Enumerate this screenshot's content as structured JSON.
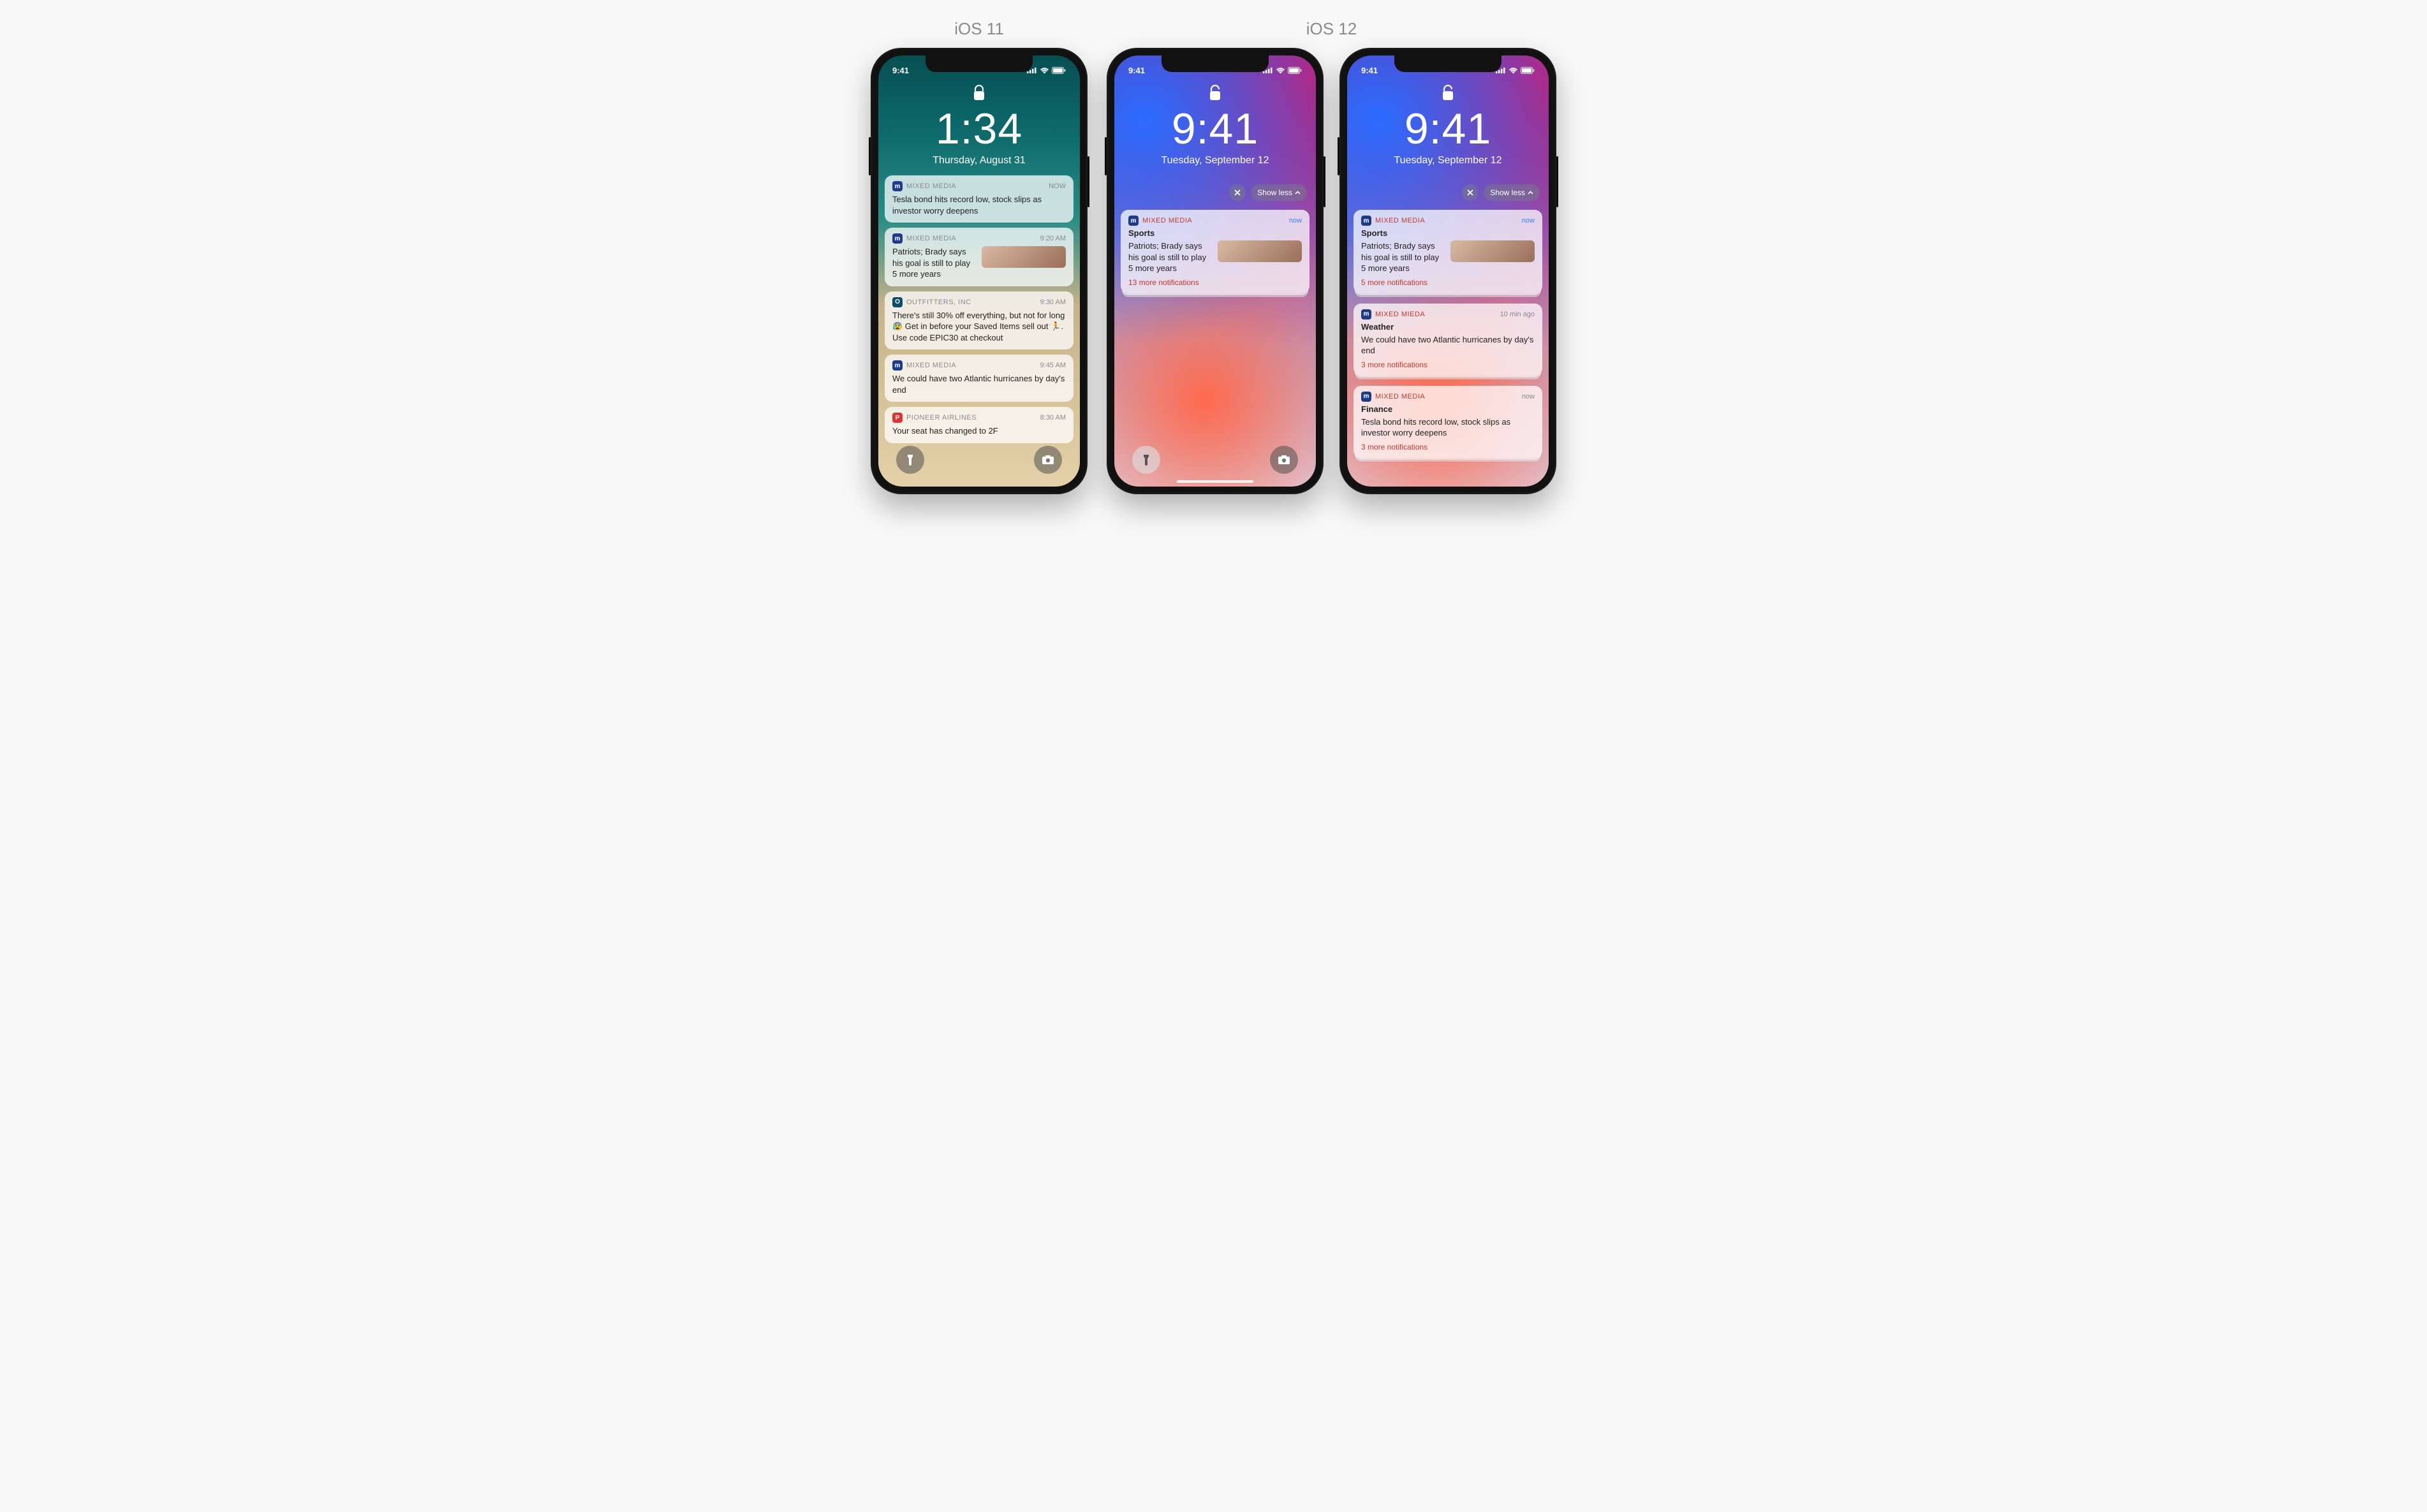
{
  "labels": {
    "ios11": "iOS 11",
    "ios12": "iOS 12"
  },
  "status": {
    "time": "9:41"
  },
  "controls": {
    "showless": "Show less"
  },
  "p1": {
    "time": "1:34",
    "date": "Thursday, August 31",
    "n": [
      {
        "app": "MIXED MEDIA",
        "when": "NOW",
        "body": "Tesla bond hits record low, stock slips as investor worry deepens"
      },
      {
        "app": "MIXED MEDIA",
        "when": "9:20 AM",
        "body": "Patriots; Brady says his goal is still to play 5 more years",
        "thumb": true
      },
      {
        "app": "OUTFITTERS, INC",
        "when": "9:30 AM",
        "body": "There's still 30% off everything, but not for long 😰 Get in before your Saved Items sell out 🏃. Use code EPIC30 at checkout",
        "ico": "out"
      },
      {
        "app": "MIXED MEDIA",
        "when": "9:45 AM",
        "body": "We could have two Atlantic hurricanes by day's end"
      },
      {
        "app": "PIONEER AIRLINES",
        "when": "8:30 AM",
        "body": "Your seat has changed to 2F",
        "ico": "pio"
      }
    ]
  },
  "p2": {
    "time": "9:41",
    "date": "Tuesday, September 12",
    "n": [
      {
        "app": "MIXED MEDIA",
        "when": "now",
        "title": "Sports",
        "body": "Patriots; Brady says his goal is still to play 5 more years",
        "thumb": true,
        "more": "13 more notifications"
      }
    ]
  },
  "p3": {
    "time": "9:41",
    "date": "Tuesday, September 12",
    "n": [
      {
        "app": "MIXED MEDIA",
        "when": "now",
        "title": "Sports",
        "body": "Patriots; Brady says his goal is still to play 5 more years",
        "thumb": true,
        "more": "5 more notifications"
      },
      {
        "app": "MIXED MIEDA",
        "when": "10 min ago",
        "title": "Weather",
        "body": "We could have two Atlantic hurricanes by day's end",
        "more": "3 more notifications"
      },
      {
        "app": "MIXED MEDIA",
        "when": "now",
        "title": "Finance",
        "body": "Tesla bond hits record low, stock slips as investor worry deepens",
        "more": "3 more notifications"
      }
    ]
  }
}
